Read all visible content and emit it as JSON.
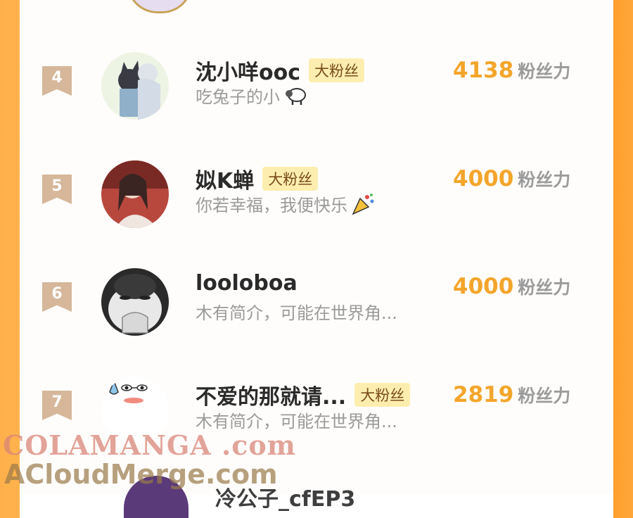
{
  "rows": [
    {
      "rank": "4",
      "name": "沈小咩ooc",
      "badge": "大粉丝",
      "bio": "吃兔子的小",
      "bio_emoji": "sheep-icon",
      "score": "4138",
      "unit": "粉丝力"
    },
    {
      "rank": "5",
      "name": "姒K蝉",
      "badge": "大粉丝",
      "bio": "你若幸福，我便快乐",
      "bio_emoji": "party-popper-icon",
      "score": "4000",
      "unit": "粉丝力"
    },
    {
      "rank": "6",
      "name": "looloboa",
      "badge": "",
      "bio": "木有简介，可能在世界角...",
      "bio_emoji": "",
      "score": "4000",
      "unit": "粉丝力"
    },
    {
      "rank": "7",
      "name": "不爱的那就请...",
      "badge": "大粉丝",
      "bio": "木有简介，可能在世界角...",
      "bio_emoji": "",
      "score": "2819",
      "unit": "粉丝力"
    }
  ],
  "partial_bottom_name": "冷公子_cfEP3",
  "watermark": {
    "line1": "COLAMANGA .com",
    "line2": "ACloudMerge.com"
  }
}
